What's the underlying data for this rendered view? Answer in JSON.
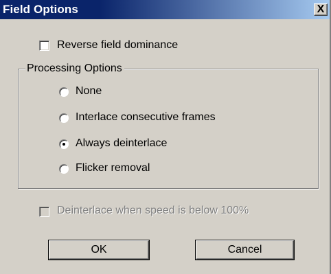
{
  "window": {
    "title": "Field Options",
    "close_glyph": "X"
  },
  "reverse_field": {
    "label": "Reverse field dominance",
    "checked": false
  },
  "processing": {
    "group_label": "Processing Options",
    "options": [
      {
        "label": "None",
        "selected": false
      },
      {
        "label": "Interlace consecutive frames",
        "selected": false
      },
      {
        "label": "Always deinterlace",
        "selected": true
      },
      {
        "label": "Flicker removal",
        "selected": false
      }
    ]
  },
  "deinterlace_speed": {
    "label": "Deinterlace when speed is below 100%",
    "checked": false,
    "enabled": false
  },
  "buttons": {
    "ok": "OK",
    "cancel": "Cancel"
  }
}
